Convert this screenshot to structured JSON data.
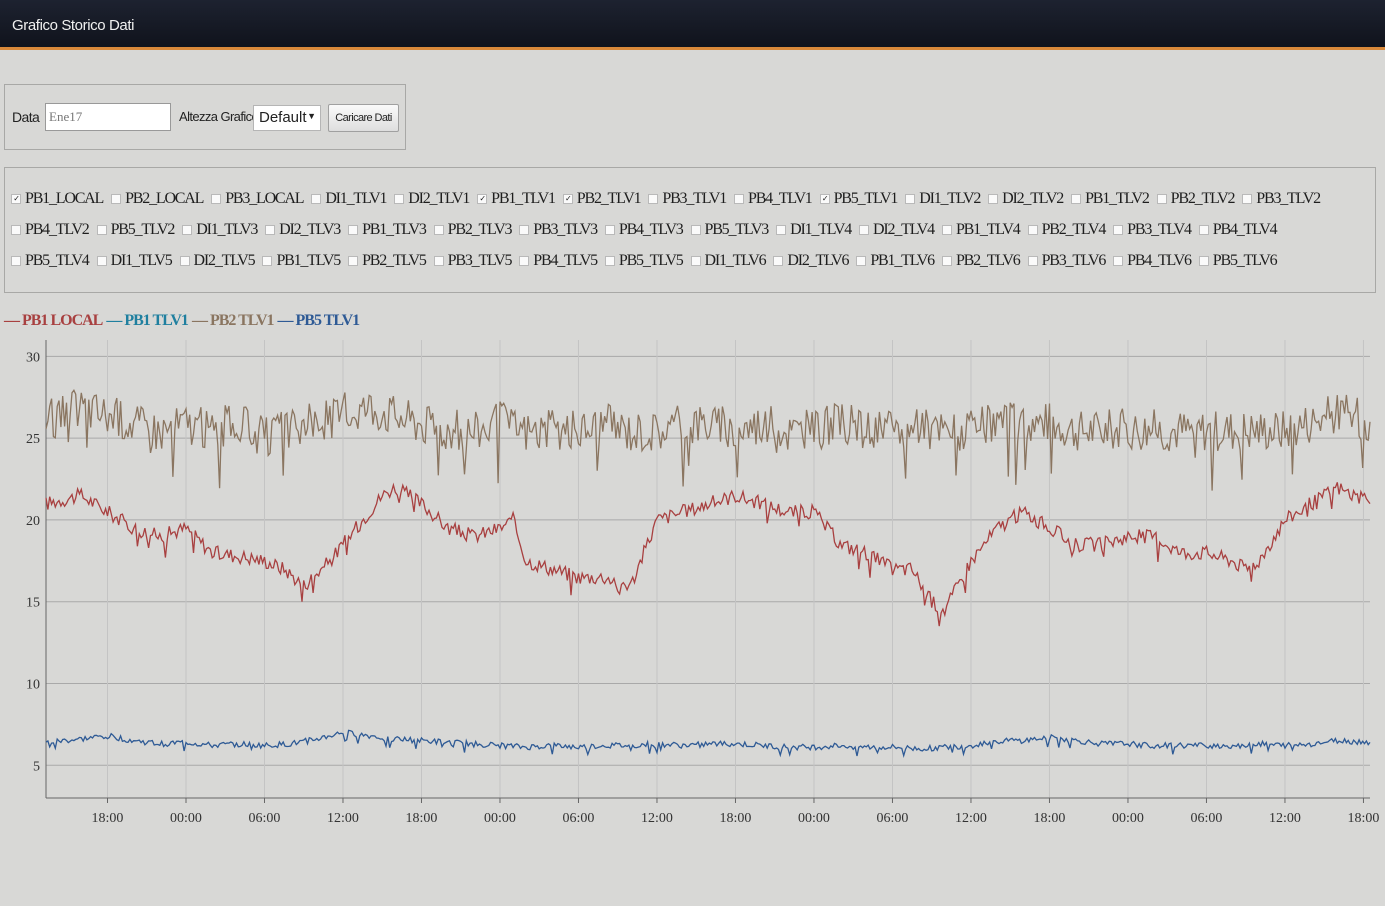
{
  "window": {
    "title": "Grafico Storico Dati"
  },
  "controls": {
    "data_label": "Data",
    "data_value": "Ene17",
    "altezza_label": "Altezza Grafico",
    "altezza_value": "Default",
    "load_button": "Caricare Dati"
  },
  "series_options": [
    {
      "label": "PB1_LOCAL",
      "checked": true
    },
    {
      "label": "PB2_LOCAL",
      "checked": false
    },
    {
      "label": "PB3_LOCAL",
      "checked": false
    },
    {
      "label": "DI1_TLV1",
      "checked": false
    },
    {
      "label": "DI2_TLV1",
      "checked": false
    },
    {
      "label": "PB1_TLV1",
      "checked": true
    },
    {
      "label": "PB2_TLV1",
      "checked": true
    },
    {
      "label": "PB3_TLV1",
      "checked": false
    },
    {
      "label": "PB4_TLV1",
      "checked": false
    },
    {
      "label": "PB5_TLV1",
      "checked": true
    },
    {
      "label": "DI1_TLV2",
      "checked": false
    },
    {
      "label": "DI2_TLV2",
      "checked": false
    },
    {
      "label": "PB1_TLV2",
      "checked": false
    },
    {
      "label": "PB2_TLV2",
      "checked": false
    },
    {
      "label": "PB3_TLV2",
      "checked": false
    },
    {
      "label": "PB4_TLV2",
      "checked": false
    },
    {
      "label": "PB5_TLV2",
      "checked": false
    },
    {
      "label": "DI1_TLV3",
      "checked": false
    },
    {
      "label": "DI2_TLV3",
      "checked": false
    },
    {
      "label": "PB1_TLV3",
      "checked": false
    },
    {
      "label": "PB2_TLV3",
      "checked": false
    },
    {
      "label": "PB3_TLV3",
      "checked": false
    },
    {
      "label": "PB4_TLV3",
      "checked": false
    },
    {
      "label": "PB5_TLV3",
      "checked": false
    },
    {
      "label": "DI1_TLV4",
      "checked": false
    },
    {
      "label": "DI2_TLV4",
      "checked": false
    },
    {
      "label": "PB1_TLV4",
      "checked": false
    },
    {
      "label": "PB2_TLV4",
      "checked": false
    },
    {
      "label": "PB3_TLV4",
      "checked": false
    },
    {
      "label": "PB4_TLV4",
      "checked": false
    },
    {
      "label": "PB5_TLV4",
      "checked": false
    },
    {
      "label": "DI1_TLV5",
      "checked": false
    },
    {
      "label": "DI2_TLV5",
      "checked": false
    },
    {
      "label": "PB1_TLV5",
      "checked": false
    },
    {
      "label": "PB2_TLV5",
      "checked": false
    },
    {
      "label": "PB3_TLV5",
      "checked": false
    },
    {
      "label": "PB4_TLV5",
      "checked": false
    },
    {
      "label": "PB5_TLV5",
      "checked": false
    },
    {
      "label": "DI1_TLV6",
      "checked": false
    },
    {
      "label": "DI2_TLV6",
      "checked": false
    },
    {
      "label": "PB1_TLV6",
      "checked": false
    },
    {
      "label": "PB2_TLV6",
      "checked": false
    },
    {
      "label": "PB3_TLV6",
      "checked": false
    },
    {
      "label": "PB4_TLV6",
      "checked": false
    },
    {
      "label": "PB5_TLV6",
      "checked": false
    }
  ],
  "chart_data": {
    "type": "line",
    "legend_position": "top-left",
    "grid": true,
    "ylim": [
      3,
      31
    ],
    "yticks": [
      5,
      10,
      15,
      20,
      25,
      30
    ],
    "xticks": [
      "18:00",
      "00:00",
      "06:00",
      "12:00",
      "18:00",
      "00:00",
      "06:00",
      "12:00",
      "18:00",
      "00:00",
      "06:00",
      "12:00",
      "18:00",
      "00:00",
      "06:00",
      "12:00",
      "18:00"
    ],
    "xtick_hours": [
      18,
      24,
      30,
      36,
      42,
      48,
      54,
      60,
      66,
      72,
      78,
      84,
      90,
      96,
      102,
      108,
      114
    ],
    "xlim_hours": [
      13.3,
      114.5
    ],
    "series": [
      {
        "name": "PB1 LOCAL",
        "color": "#a84040",
        "x": [
          13.3,
          16,
          18,
          20,
          22,
          24,
          26,
          28,
          30,
          31.5,
          33,
          35,
          37,
          39,
          40,
          42,
          44,
          46,
          48,
          49,
          50,
          52,
          54,
          56,
          58,
          60,
          62,
          64,
          66,
          68,
          70,
          72,
          74,
          76,
          78,
          79.5,
          81,
          82,
          84,
          86,
          88,
          90,
          92,
          94,
          96,
          98,
          100,
          102,
          104,
          105,
          106,
          108,
          110,
          112,
          114.5
        ],
        "y": [
          21,
          21.5,
          20.5,
          19.5,
          19,
          19.5,
          18,
          17.8,
          17.5,
          17,
          16,
          17.5,
          19.5,
          21.5,
          22,
          21,
          19.5,
          19,
          19.5,
          20,
          17.5,
          17,
          16.5,
          16.5,
          16,
          20,
          20.5,
          21,
          21.5,
          21,
          20.5,
          20.5,
          18.5,
          18,
          17,
          17,
          15,
          14.5,
          17.5,
          19.5,
          20.5,
          19.5,
          18.5,
          18.5,
          19,
          19,
          18,
          18,
          17.5,
          17,
          17.5,
          20,
          21,
          22,
          21
        ]
      },
      {
        "name": "PB1 TLV1",
        "color": "#1f7f9f",
        "x": [
          13.3,
          114.5
        ],
        "y": [
          6.5,
          6.5
        ]
      },
      {
        "name": "PB2 TLV1",
        "color": "#8a7560",
        "x": [
          13.3,
          16,
          18,
          20,
          22,
          24,
          26,
          28,
          30,
          32,
          34,
          36,
          38,
          40,
          42,
          44,
          46,
          48,
          50,
          52,
          54,
          56,
          58,
          60,
          62,
          64,
          66,
          68,
          70,
          72,
          74,
          76,
          78,
          80,
          82,
          84,
          86,
          88,
          90,
          92,
          94,
          96,
          98,
          100,
          102,
          104,
          106,
          108,
          110,
          112,
          114.5
        ],
        "y": [
          26,
          27,
          26.5,
          26,
          25.5,
          26,
          25.5,
          26,
          25,
          25.5,
          26,
          26.5,
          27,
          26.5,
          26,
          25.5,
          25.5,
          26,
          25.5,
          25.5,
          25.5,
          26,
          25.5,
          25.5,
          26,
          26,
          25.5,
          26,
          25.5,
          25.5,
          26,
          25.5,
          25.5,
          25.5,
          25.5,
          25.5,
          26,
          26,
          26,
          25.5,
          25.5,
          25.5,
          25.5,
          25.5,
          25.5,
          25.5,
          25.5,
          25.5,
          26,
          26.5,
          26
        ]
      },
      {
        "name": "PB5 TLV1",
        "color": "#2e5a95",
        "x": [
          13.3,
          16,
          18,
          20,
          22,
          24,
          26,
          28,
          30,
          32,
          34,
          36,
          38,
          40,
          42,
          44,
          46,
          48,
          50,
          52,
          54,
          56,
          58,
          60,
          62,
          64,
          66,
          68,
          70,
          72,
          74,
          76,
          78,
          80,
          82,
          84,
          86,
          88,
          90,
          92,
          94,
          96,
          98,
          100,
          102,
          104,
          106,
          108,
          110,
          112,
          114.5
        ],
        "y": [
          6.4,
          6.6,
          6.8,
          6.5,
          6.3,
          6.4,
          6.2,
          6.3,
          6.2,
          6.3,
          6.6,
          7,
          6.8,
          6.6,
          6.5,
          6.4,
          6.3,
          6.2,
          6.1,
          6.2,
          6.1,
          6.2,
          6.2,
          6.3,
          6.2,
          6.3,
          6.3,
          6.2,
          6.1,
          6.1,
          6.2,
          6.1,
          6.1,
          6,
          6.1,
          6.2,
          6.5,
          6.5,
          6.7,
          6.5,
          6.3,
          6.3,
          6.2,
          6.2,
          6.2,
          6.2,
          6.3,
          6.2,
          6.3,
          6.5,
          6.4
        ]
      }
    ]
  }
}
